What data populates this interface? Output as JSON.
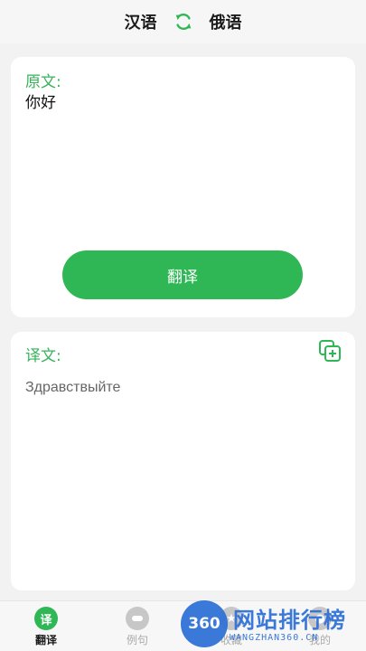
{
  "header": {
    "source_language": "汉语",
    "target_language": "俄语",
    "swap_icon": "swap-arrows-icon"
  },
  "source_panel": {
    "label": "原文:",
    "text": "你好",
    "translate_button": "翻译"
  },
  "target_panel": {
    "label": "译文:",
    "text": "Здравствыйте",
    "copy_icon": "copy-add-icon"
  },
  "bottom_nav": {
    "items": [
      {
        "label": "翻译",
        "icon_text": "译",
        "active": true
      },
      {
        "label": "例句",
        "icon_text": "",
        "active": false
      },
      {
        "label": "收藏",
        "icon_text": "",
        "active": false
      },
      {
        "label": "我的",
        "icon_text": "",
        "active": false
      }
    ]
  },
  "watermark": {
    "badge": "360",
    "title": "网站排行榜",
    "subtitle": "WANGZHAN360.CN"
  },
  "colors": {
    "accent": "#2fb756",
    "label": "#34b35a",
    "watermark": "#2c6fd6"
  }
}
